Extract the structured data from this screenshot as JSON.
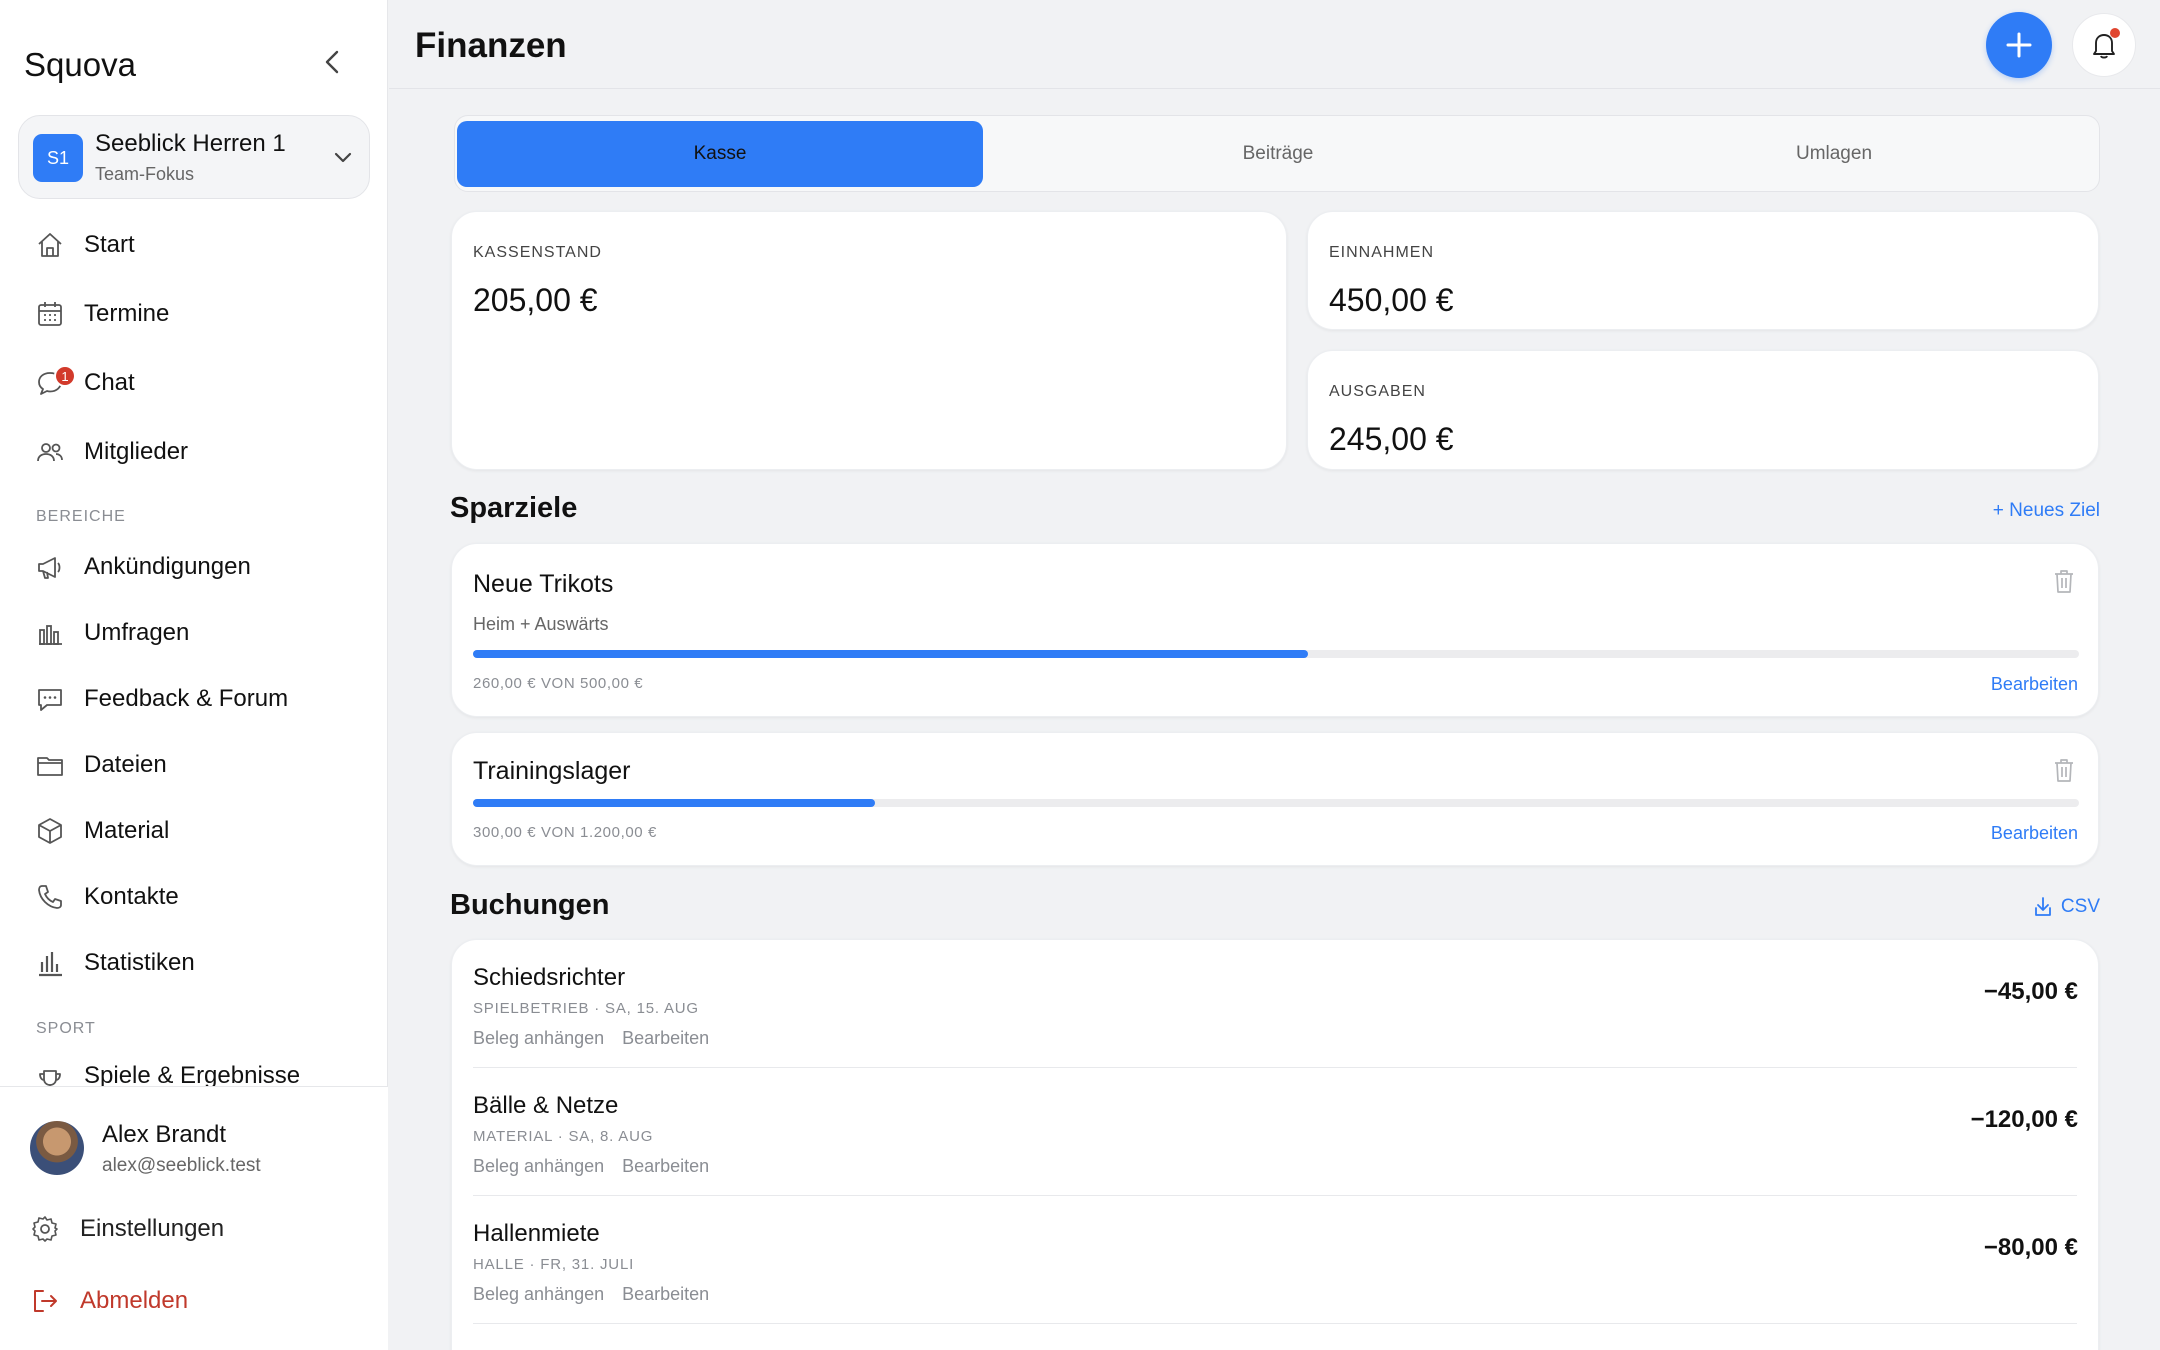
{
  "app": {
    "brand": "Squova"
  },
  "team": {
    "badge": "S1",
    "name": "Seeblick Herren 1",
    "subtitle": "Team-Fokus"
  },
  "nav": {
    "main": [
      {
        "label": "Start",
        "icon": "home-icon"
      },
      {
        "label": "Termine",
        "icon": "calendar-icon"
      },
      {
        "label": "Chat",
        "icon": "chat-icon",
        "badge": "1"
      },
      {
        "label": "Mitglieder",
        "icon": "users-icon"
      }
    ],
    "section_bereiche": "BEREICHE",
    "bereiche": [
      {
        "label": "Ankündigungen",
        "icon": "megaphone-icon"
      },
      {
        "label": "Umfragen",
        "icon": "poll-icon"
      },
      {
        "label": "Feedback & Forum",
        "icon": "forum-icon"
      },
      {
        "label": "Dateien",
        "icon": "folder-icon"
      },
      {
        "label": "Material",
        "icon": "box-icon"
      },
      {
        "label": "Kontakte",
        "icon": "phone-icon"
      },
      {
        "label": "Statistiken",
        "icon": "stats-icon"
      }
    ],
    "section_sport": "SPORT",
    "sport": [
      {
        "label": "Spiele & Ergebnisse",
        "icon": "trophy-icon"
      }
    ]
  },
  "user": {
    "name": "Alex Brandt",
    "email": "alex@seeblick.test"
  },
  "footer": {
    "settings": "Einstellungen",
    "logout": "Abmelden"
  },
  "header": {
    "title": "Finanzen"
  },
  "tabs": [
    {
      "label": "Kasse",
      "active": true
    },
    {
      "label": "Beiträge",
      "active": false
    },
    {
      "label": "Umlagen",
      "active": false
    }
  ],
  "stats": {
    "balance": {
      "label": "KASSENSTAND",
      "value": "205,00 €"
    },
    "income": {
      "label": "EINNAHMEN",
      "value": "450,00 €"
    },
    "expenses": {
      "label": "AUSGABEN",
      "value": "245,00 €"
    }
  },
  "goals": {
    "title": "Sparziele",
    "new_label": "+ Neues Ziel",
    "items": [
      {
        "title": "Neue Trikots",
        "subtitle": "Heim + Auswärts",
        "amount": "260,00 € VON 500,00 €",
        "progress": 0.52,
        "edit": "Bearbeiten"
      },
      {
        "title": "Trainingslager",
        "subtitle": "",
        "amount": "300,00 € VON 1.200,00 €",
        "progress": 0.25,
        "edit": "Bearbeiten"
      }
    ]
  },
  "bookings": {
    "title": "Buchungen",
    "csv_label": "CSV",
    "items": [
      {
        "title": "Schiedsrichter",
        "meta": "SPIELBETRIEB · SA, 15. AUG",
        "attach": "Beleg anhängen",
        "edit": "Bearbeiten",
        "amount": "−45,00 €"
      },
      {
        "title": "Bälle & Netze",
        "meta": "MATERIAL · SA, 8. AUG",
        "attach": "Beleg anhängen",
        "edit": "Bearbeiten",
        "amount": "−120,00 €"
      },
      {
        "title": "Hallenmiete",
        "meta": "HALLE · FR, 31. JULI",
        "attach": "Beleg anhängen",
        "edit": "Bearbeiten",
        "amount": "−80,00 €"
      }
    ]
  },
  "colors": {
    "accent": "#2f7cf6",
    "danger": "#d23a2b",
    "background": "#f1f2f4"
  }
}
